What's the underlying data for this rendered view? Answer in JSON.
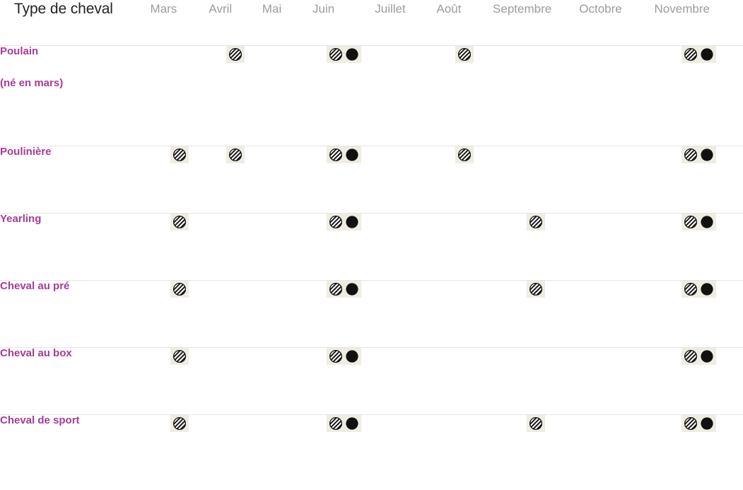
{
  "table": {
    "header": {
      "type_column_label": "Type de cheval",
      "months": [
        "Mars",
        "Avril",
        "Mai",
        "Juin",
        "Juillet",
        "Août",
        "Septembre",
        "Octobre",
        "Novembre"
      ]
    },
    "legend_glyphs": {
      "hatched": "hatched-circle-icon",
      "filled": "filled-circle-icon"
    },
    "colors": {
      "row_label": "#a8399b",
      "header_title": "#222222",
      "month_label": "#9c9c9c",
      "row_divider": "#e4e4e4",
      "marker_background": "#efece1",
      "marker_fill": "#111111",
      "page_background": "#ffffff"
    },
    "rows": [
      {
        "name": "Poulain",
        "note": "(né en mars)",
        "cells": [
          [],
          [
            "hatched"
          ],
          [],
          [
            "hatched",
            "filled"
          ],
          [],
          [
            "hatched"
          ],
          [],
          [],
          [
            "hatched",
            "filled"
          ]
        ]
      },
      {
        "name": "Poulinière",
        "note": "",
        "cells": [
          [
            "hatched"
          ],
          [
            "hatched"
          ],
          [],
          [
            "hatched",
            "filled"
          ],
          [],
          [
            "hatched"
          ],
          [],
          [],
          [
            "hatched",
            "filled"
          ]
        ]
      },
      {
        "name": "Yearling",
        "note": "",
        "cells": [
          [
            "hatched"
          ],
          [],
          [],
          [
            "hatched",
            "filled"
          ],
          [],
          [],
          [
            "hatched"
          ],
          [],
          [
            "hatched",
            "filled"
          ]
        ]
      },
      {
        "name": "Cheval au pré",
        "note": "",
        "cells": [
          [
            "hatched"
          ],
          [],
          [],
          [
            "hatched",
            "filled"
          ],
          [],
          [],
          [
            "hatched"
          ],
          [],
          [
            "hatched",
            "filled"
          ]
        ]
      },
      {
        "name": "Cheval au box",
        "note": "",
        "cells": [
          [
            "hatched"
          ],
          [],
          [],
          [
            "hatched",
            "filled"
          ],
          [],
          [],
          [],
          [],
          [
            "hatched",
            "filled"
          ]
        ]
      },
      {
        "name": "Cheval de sport",
        "note": "",
        "cells": [
          [
            "hatched"
          ],
          [],
          [],
          [
            "hatched",
            "filled"
          ],
          [],
          [],
          [
            "hatched"
          ],
          [],
          [
            "hatched",
            "filled"
          ]
        ]
      }
    ]
  }
}
